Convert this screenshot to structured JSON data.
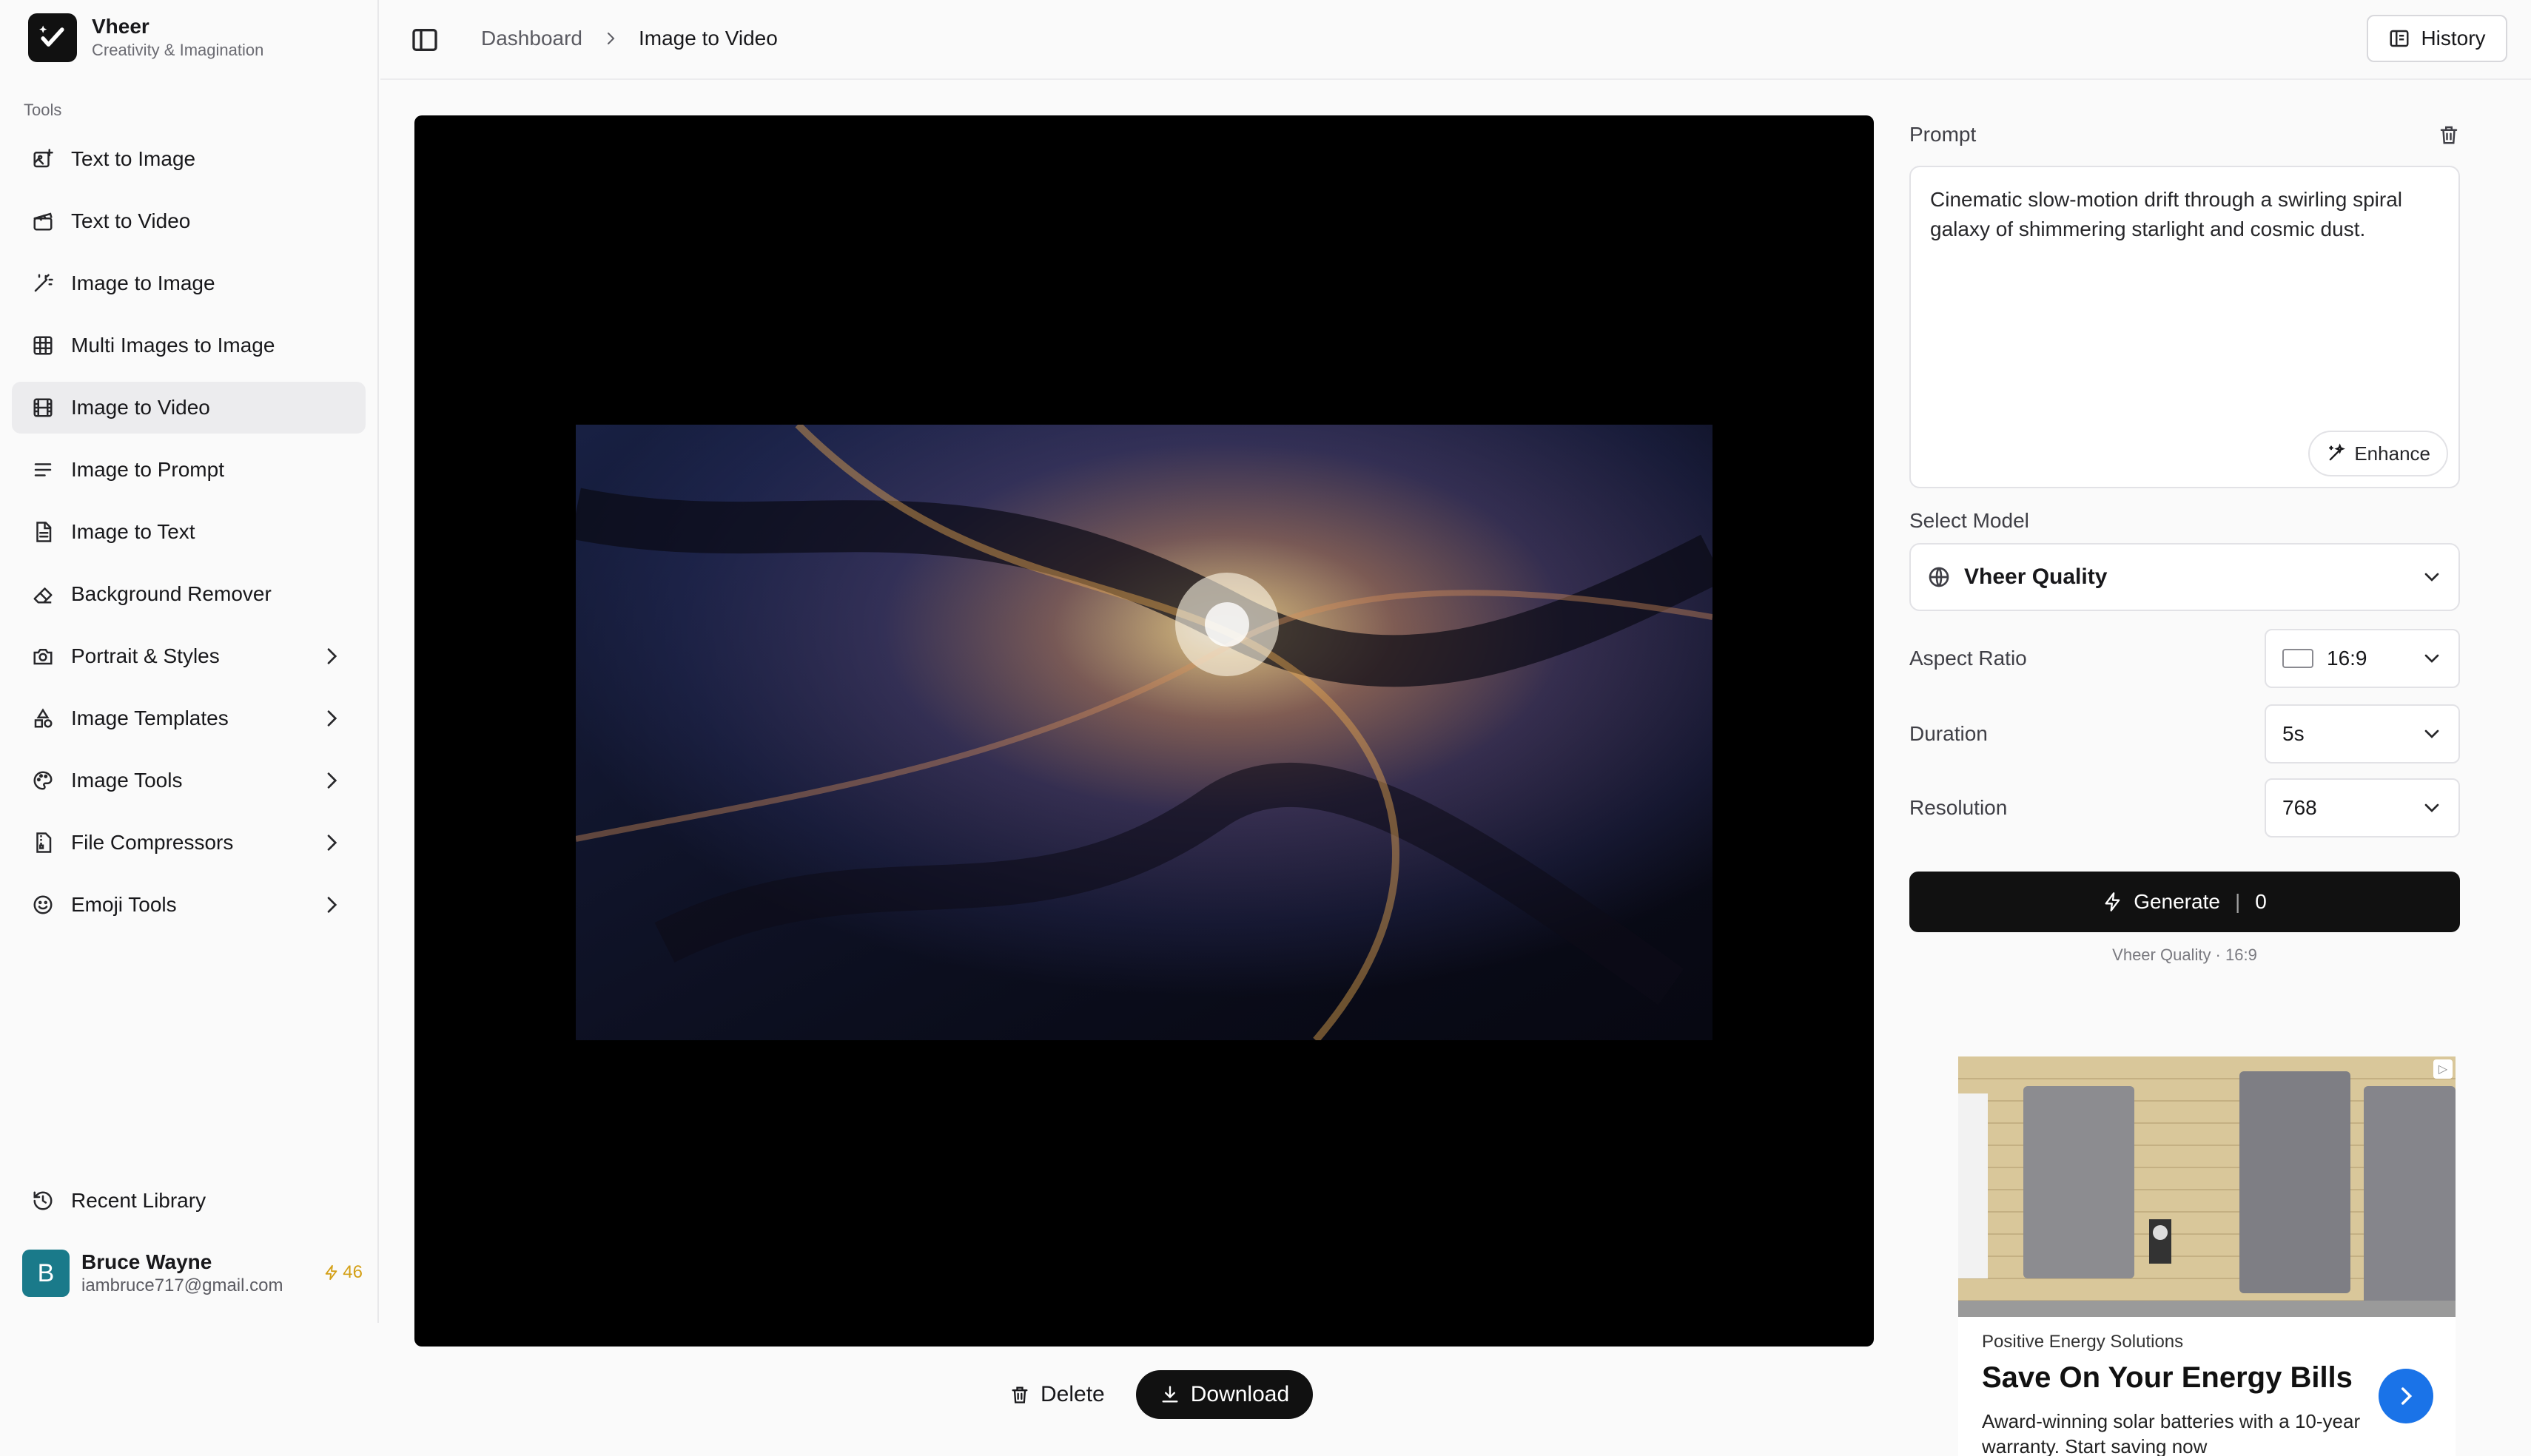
{
  "app": {
    "name": "Vheer",
    "tagline": "Creativity & Imagination"
  },
  "sidebar": {
    "section_label": "Tools",
    "items": [
      {
        "label": "Text to Image",
        "icon": "image-plus-icon"
      },
      {
        "label": "Text to Video",
        "icon": "clapperboard-icon"
      },
      {
        "label": "Image to Image",
        "icon": "wand-icon"
      },
      {
        "label": "Multi Images to Image",
        "icon": "grid-icon"
      },
      {
        "label": "Image to Video",
        "icon": "film-icon",
        "active": true
      },
      {
        "label": "Image to Prompt",
        "icon": "text-lines-icon"
      },
      {
        "label": "Image to Text",
        "icon": "file-text-icon"
      },
      {
        "label": "Background Remover",
        "icon": "eraser-icon"
      },
      {
        "label": "Portrait & Styles",
        "icon": "camera-icon",
        "expandable": true
      },
      {
        "label": "Image Templates",
        "icon": "shapes-icon",
        "expandable": true
      },
      {
        "label": "Image Tools",
        "icon": "palette-icon",
        "expandable": true
      },
      {
        "label": "File Compressors",
        "icon": "file-zip-icon",
        "expandable": true
      },
      {
        "label": "Emoji Tools",
        "icon": "smile-icon",
        "expandable": true
      }
    ],
    "recent_label": "Recent Library"
  },
  "user": {
    "initial": "B",
    "name": "Bruce Wayne",
    "email": "iambruce717@gmail.com",
    "credits": "46"
  },
  "topbar": {
    "breadcrumb_root": "Dashboard",
    "breadcrumb_current": "Image to Video",
    "history_label": "History"
  },
  "viewer": {
    "delete_label": "Delete",
    "download_label": "Download"
  },
  "panel": {
    "prompt_label": "Prompt",
    "prompt_text": "Cinematic slow-motion drift through a swirling spiral galaxy of shimmering starlight and cosmic dust.",
    "enhance_label": "Enhance",
    "model_label": "Select Model",
    "model_value": "Vheer Quality",
    "aspect_label": "Aspect Ratio",
    "aspect_value": "16:9",
    "duration_label": "Duration",
    "duration_value": "5s",
    "resolution_label": "Resolution",
    "resolution_value": "768",
    "generate_label": "Generate",
    "generate_cost": "0",
    "generate_meta": "Vheer Quality · 16:9"
  },
  "ad": {
    "advertiser": "Positive Energy Solutions",
    "title": "Save On Your Energy Bills",
    "body": "Award-winning solar batteries with a 10-year warranty. Start saving now"
  },
  "colors": {
    "accent": "#111111",
    "credits": "#d4a017",
    "avatar": "#1a7a8a",
    "ad_button": "#1a73e8"
  }
}
